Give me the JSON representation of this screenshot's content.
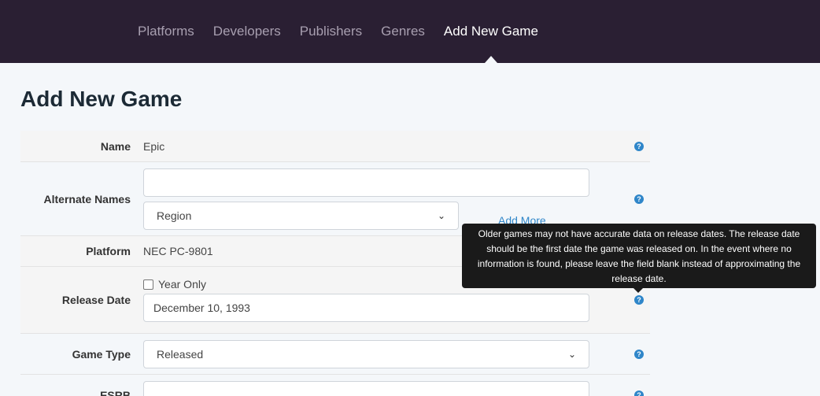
{
  "nav": {
    "items": [
      {
        "label": "Platforms",
        "active": false
      },
      {
        "label": "Developers",
        "active": false
      },
      {
        "label": "Publishers",
        "active": false
      },
      {
        "label": "Genres",
        "active": false
      },
      {
        "label": "Add New Game",
        "active": true
      }
    ]
  },
  "page": {
    "title": "Add New Game"
  },
  "form": {
    "name": {
      "label": "Name",
      "value": "Epic"
    },
    "alternate_names": {
      "label": "Alternate Names",
      "input_value": "",
      "region_select": "Region",
      "add_more": "Add More"
    },
    "platform": {
      "label": "Platform",
      "value": "NEC PC-9801"
    },
    "release_date": {
      "label": "Release Date",
      "year_only_label": "Year Only",
      "year_only_checked": false,
      "value": "December 10, 1993"
    },
    "game_type": {
      "label": "Game Type",
      "value": "Released"
    },
    "esrb": {
      "label": "ESRB",
      "value": ""
    }
  },
  "tooltip": {
    "text": "Older games may not have accurate data on release dates. The release date should be the first date the game was released on. In the event where no information is found, please leave the field blank instead of approximating the release date."
  },
  "icons": {
    "help": "question-circle-icon",
    "select": "chevron-down-icon"
  },
  "colors": {
    "nav_bg": "#2a1f33",
    "link": "#2f86c9",
    "tooltip_bg": "#1a1a1a"
  }
}
